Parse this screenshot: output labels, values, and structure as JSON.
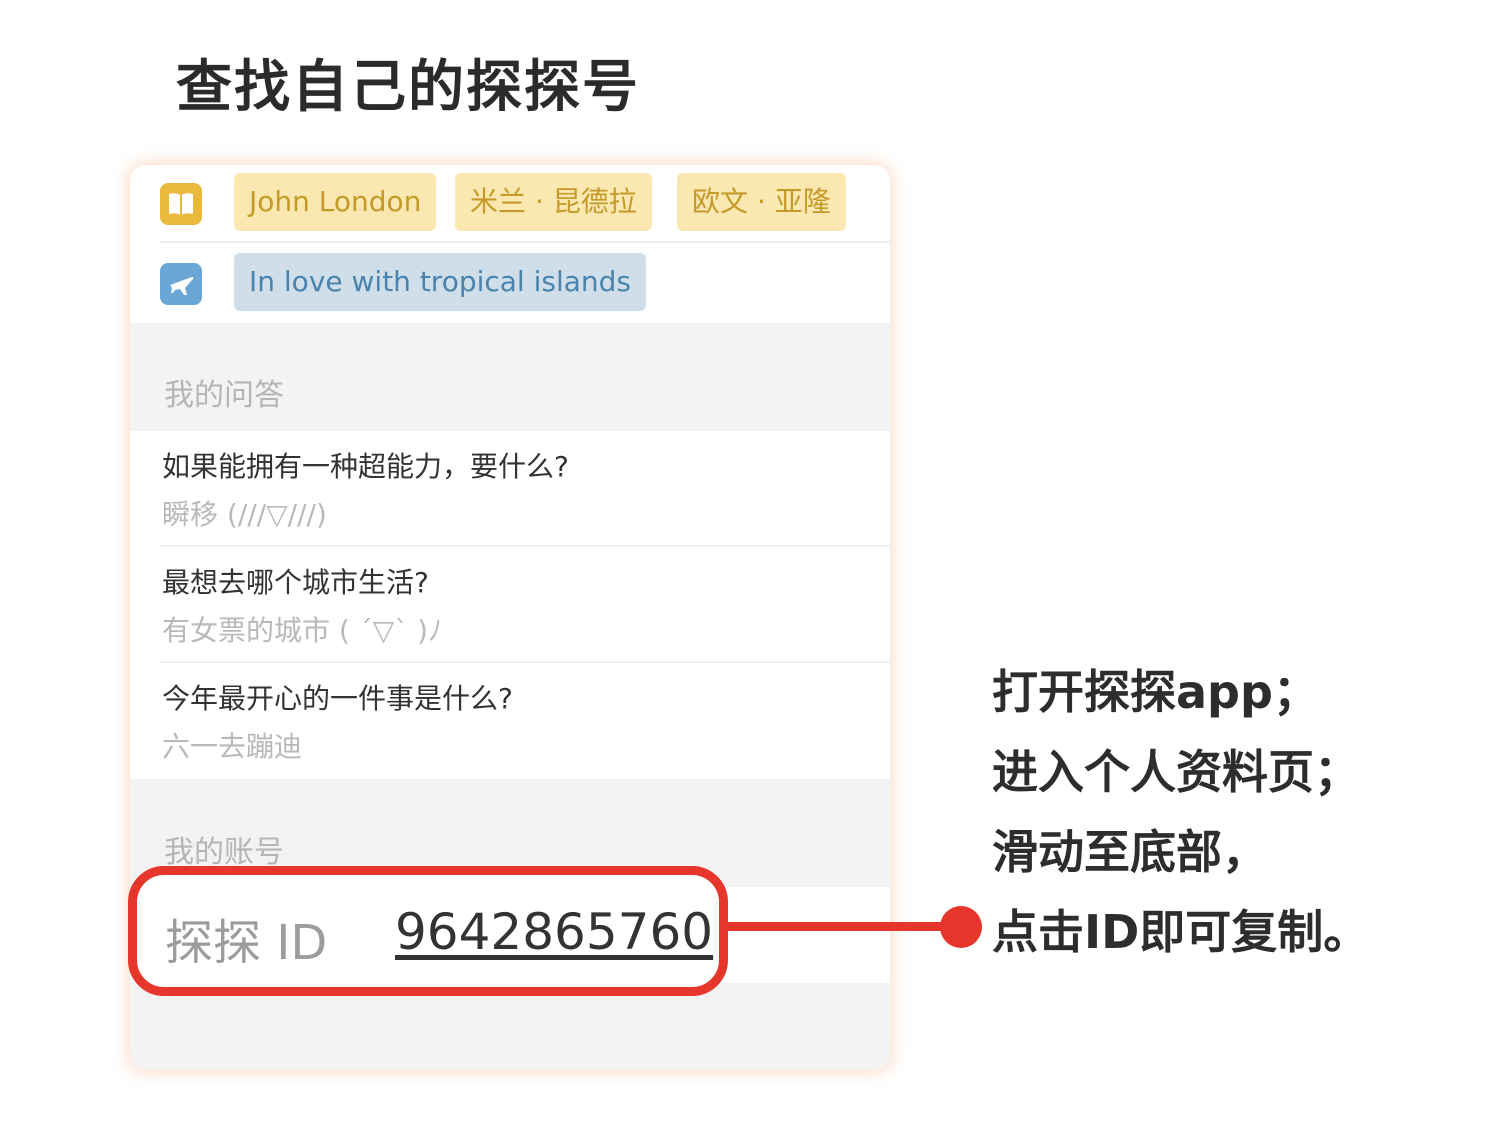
{
  "title": "查找自己的探探号",
  "profile": {
    "book_tags": [
      "John London",
      "米兰 · 昆德拉",
      "欧文 · 亚隆"
    ],
    "travel_tags": [
      "In love with tropical islands"
    ],
    "icons": {
      "book": "open-book-icon",
      "travel": "airplane-icon",
      "book_color": "#e8b93b",
      "travel_color": "#6aa6d6"
    }
  },
  "qa_section": {
    "header": "我的问答",
    "items": [
      {
        "question": "如果能拥有一种超能力，要什么?",
        "answer": "瞬移 (///▽///)"
      },
      {
        "question": "最想去哪个城市生活?",
        "answer": "有女票的城市 ( ´▽` )ﾉ"
      },
      {
        "question": "今年最开心的一件事是什么?",
        "answer": "六一去蹦迪"
      }
    ]
  },
  "account_section": {
    "header": "我的账号",
    "id_label": "探探 ID",
    "id_value": "9642865760"
  },
  "instructions": [
    "打开探探app；",
    "进入个人资料页；",
    "滑动至底部，",
    "点击ID即可复制。"
  ],
  "colors": {
    "highlight": "#e6352a",
    "book_tag_bg": "#fbe7b0",
    "book_tag_text": "#c49a28",
    "travel_tag_bg": "#cfdee9",
    "travel_tag_text": "#4a84ad"
  }
}
